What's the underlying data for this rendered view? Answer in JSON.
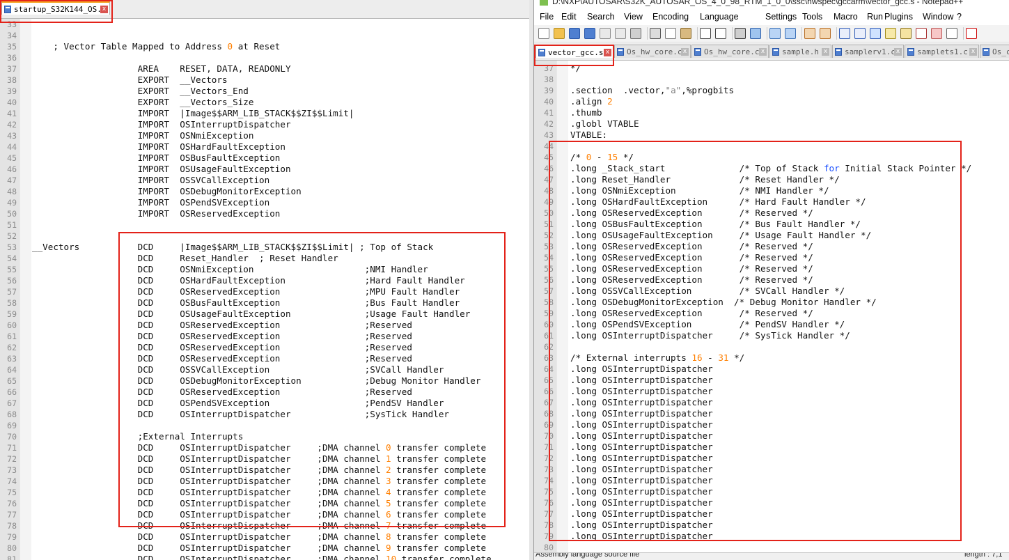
{
  "left_pane": {
    "tab": {
      "label": "startup_S32K144_OS.s",
      "close": "x"
    },
    "lines": [
      {
        "n": "33",
        "t": ""
      },
      {
        "n": "34",
        "t": ""
      },
      {
        "n": "35",
        "t": "    ; Vector Table Mapped to Address 0 at Reset"
      },
      {
        "n": "36",
        "t": ""
      },
      {
        "n": "37",
        "t": "                    AREA    RESET, DATA, READONLY"
      },
      {
        "n": "38",
        "t": "                    EXPORT  __Vectors"
      },
      {
        "n": "39",
        "t": "                    EXPORT  __Vectors_End"
      },
      {
        "n": "40",
        "t": "                    EXPORT  __Vectors_Size"
      },
      {
        "n": "41",
        "t": "                    IMPORT  |Image$$ARM_LIB_STACK$$ZI$$Limit|"
      },
      {
        "n": "42",
        "t": "                    IMPORT  OSInterruptDispatcher"
      },
      {
        "n": "43",
        "t": "                    IMPORT  OSNmiException"
      },
      {
        "n": "44",
        "t": "                    IMPORT  OSHardFaultException"
      },
      {
        "n": "45",
        "t": "                    IMPORT  OSBusFaultException"
      },
      {
        "n": "46",
        "t": "                    IMPORT  OSUsageFaultException"
      },
      {
        "n": "47",
        "t": "                    IMPORT  OSSVCallException"
      },
      {
        "n": "48",
        "t": "                    IMPORT  OSDebugMonitorException"
      },
      {
        "n": "49",
        "t": "                    IMPORT  OSPendSVException"
      },
      {
        "n": "50",
        "t": "                    IMPORT  OSReservedException"
      },
      {
        "n": "51",
        "t": ""
      },
      {
        "n": "52",
        "t": ""
      },
      {
        "n": "53",
        "t": "__Vectors           DCD     |Image$$ARM_LIB_STACK$$ZI$$Limit| ; Top of Stack"
      },
      {
        "n": "54",
        "t": "                    DCD     Reset_Handler  ; Reset Handler"
      },
      {
        "n": "55",
        "t": "                    DCD     OSNmiException                     ;NMI Handler"
      },
      {
        "n": "56",
        "t": "                    DCD     OSHardFaultException               ;Hard Fault Handler"
      },
      {
        "n": "57",
        "t": "                    DCD     OSReservedException                ;MPU Fault Handler"
      },
      {
        "n": "58",
        "t": "                    DCD     OSBusFaultException                ;Bus Fault Handler"
      },
      {
        "n": "59",
        "t": "                    DCD     OSUsageFaultException              ;Usage Fault Handler"
      },
      {
        "n": "60",
        "t": "                    DCD     OSReservedException                ;Reserved"
      },
      {
        "n": "61",
        "t": "                    DCD     OSReservedException                ;Reserved"
      },
      {
        "n": "62",
        "t": "                    DCD     OSReservedException                ;Reserved"
      },
      {
        "n": "63",
        "t": "                    DCD     OSReservedException                ;Reserved"
      },
      {
        "n": "64",
        "t": "                    DCD     OSSVCallException                  ;SVCall Handler"
      },
      {
        "n": "65",
        "t": "                    DCD     OSDebugMonitorException            ;Debug Monitor Handler"
      },
      {
        "n": "66",
        "t": "                    DCD     OSReservedException                ;Reserved"
      },
      {
        "n": "67",
        "t": "                    DCD     OSPendSVException                  ;PendSV Handler"
      },
      {
        "n": "68",
        "t": "                    DCD     OSInterruptDispatcher              ;SysTick Handler"
      },
      {
        "n": "69",
        "t": ""
      },
      {
        "n": "70",
        "t": "                    ;External Interrupts"
      },
      {
        "n": "71",
        "t": "                    DCD     OSInterruptDispatcher     ;DMA channel 0 transfer complete"
      },
      {
        "n": "72",
        "t": "                    DCD     OSInterruptDispatcher     ;DMA channel 1 transfer complete"
      },
      {
        "n": "73",
        "t": "                    DCD     OSInterruptDispatcher     ;DMA channel 2 transfer complete"
      },
      {
        "n": "74",
        "t": "                    DCD     OSInterruptDispatcher     ;DMA channel 3 transfer complete"
      },
      {
        "n": "75",
        "t": "                    DCD     OSInterruptDispatcher     ;DMA channel 4 transfer complete"
      },
      {
        "n": "76",
        "t": "                    DCD     OSInterruptDispatcher     ;DMA channel 5 transfer complete"
      },
      {
        "n": "77",
        "t": "                    DCD     OSInterruptDispatcher     ;DMA channel 6 transfer complete"
      },
      {
        "n": "78",
        "t": "                    DCD     OSInterruptDispatcher     ;DMA channel 7 transfer complete"
      },
      {
        "n": "79",
        "t": "                    DCD     OSInterruptDispatcher     ;DMA channel 8 transfer complete"
      },
      {
        "n": "80",
        "t": "                    DCD     OSInterruptDispatcher     ;DMA channel 9 transfer complete"
      },
      {
        "n": "81",
        "t": "                    DCD     OSInterruptDispatcher     ;DMA channel 10 transfer complete"
      }
    ]
  },
  "right_pane": {
    "title": "D:\\NXP\\AUTOSAR\\S32K_AUTOSAR_OS_4_0_98_RTM_1_0_0\\ssc\\hwspec\\gccarm\\vector_gcc.s - Notepad++",
    "menu": [
      "File",
      "Edit",
      "Search",
      "View",
      "Encoding",
      "Language",
      "Settings",
      "Tools",
      "Macro",
      "Run",
      "Plugins",
      "Window",
      "?"
    ],
    "tabs": [
      {
        "label": "vector_gcc.s",
        "active": true
      },
      {
        "label": "Os_hw_core.c"
      },
      {
        "label": "Os_hw_core.c"
      },
      {
        "label": "sample.h"
      },
      {
        "label": "samplerv1.c"
      },
      {
        "label": "samplets1.c"
      },
      {
        "label": "Os_c"
      }
    ],
    "lines": [
      {
        "n": "37",
        "t": "*/"
      },
      {
        "n": "38",
        "t": ""
      },
      {
        "n": "39",
        "t": ".section  .vector,\"a\",%progbits"
      },
      {
        "n": "40",
        "t": ".align 2"
      },
      {
        "n": "41",
        "t": ".thumb"
      },
      {
        "n": "42",
        "t": ".globl VTABLE"
      },
      {
        "n": "43",
        "t": "VTABLE:"
      },
      {
        "n": "44",
        "t": ""
      },
      {
        "n": "45",
        "t": "/* 0 - 15 */"
      },
      {
        "n": "46",
        "t": ".long _Stack_start              /* Top of Stack for Initial Stack Pointer */"
      },
      {
        "n": "47",
        "t": ".long Reset_Handler             /* Reset Handler */"
      },
      {
        "n": "48",
        "t": ".long OSNmiException            /* NMI Handler */"
      },
      {
        "n": "49",
        "t": ".long OSHardFaultException      /* Hard Fault Handler */"
      },
      {
        "n": "50",
        "t": ".long OSReservedException       /* Reserved */"
      },
      {
        "n": "51",
        "t": ".long OSBusFaultException       /* Bus Fault Handler */"
      },
      {
        "n": "52",
        "t": ".long OSUsageFaultException     /* Usage Fault Handler */"
      },
      {
        "n": "53",
        "t": ".long OSReservedException       /* Reserved */"
      },
      {
        "n": "54",
        "t": ".long OSReservedException       /* Reserved */"
      },
      {
        "n": "55",
        "t": ".long OSReservedException       /* Reserved */"
      },
      {
        "n": "56",
        "t": ".long OSReservedException       /* Reserved */"
      },
      {
        "n": "57",
        "t": ".long OSSVCallException         /* SVCall Handler */"
      },
      {
        "n": "58",
        "t": ".long OSDebugMonitorException  /* Debug Monitor Handler */"
      },
      {
        "n": "59",
        "t": ".long OSReservedException       /* Reserved */"
      },
      {
        "n": "60",
        "t": ".long OSPendSVException         /* PendSV Handler */"
      },
      {
        "n": "61",
        "t": ".long OSInterruptDispatcher     /* SysTick Handler */"
      },
      {
        "n": "62",
        "t": ""
      },
      {
        "n": "63",
        "t": "/* External interrupts 16 - 31 */"
      },
      {
        "n": "64",
        "t": ".long OSInterruptDispatcher"
      },
      {
        "n": "65",
        "t": ".long OSInterruptDispatcher"
      },
      {
        "n": "66",
        "t": ".long OSInterruptDispatcher"
      },
      {
        "n": "67",
        "t": ".long OSInterruptDispatcher"
      },
      {
        "n": "68",
        "t": ".long OSInterruptDispatcher"
      },
      {
        "n": "69",
        "t": ".long OSInterruptDispatcher"
      },
      {
        "n": "70",
        "t": ".long OSInterruptDispatcher"
      },
      {
        "n": "71",
        "t": ".long OSInterruptDispatcher"
      },
      {
        "n": "72",
        "t": ".long OSInterruptDispatcher"
      },
      {
        "n": "73",
        "t": ".long OSInterruptDispatcher"
      },
      {
        "n": "74",
        "t": ".long OSInterruptDispatcher"
      },
      {
        "n": "75",
        "t": ".long OSInterruptDispatcher"
      },
      {
        "n": "76",
        "t": ".long OSInterruptDispatcher"
      },
      {
        "n": "77",
        "t": ".long OSInterruptDispatcher"
      },
      {
        "n": "78",
        "t": ".long OSInterruptDispatcher"
      },
      {
        "n": "79",
        "t": ".long OSInterruptDispatcher"
      },
      {
        "n": "80",
        "t": ""
      }
    ],
    "status": {
      "left": "Assembly language source file",
      "right": "length : 7,1"
    }
  },
  "colors": {
    "number": "#ff7f00",
    "string": "#808080",
    "keyword": "#1a4fff",
    "highlight_box": "#e32219"
  }
}
